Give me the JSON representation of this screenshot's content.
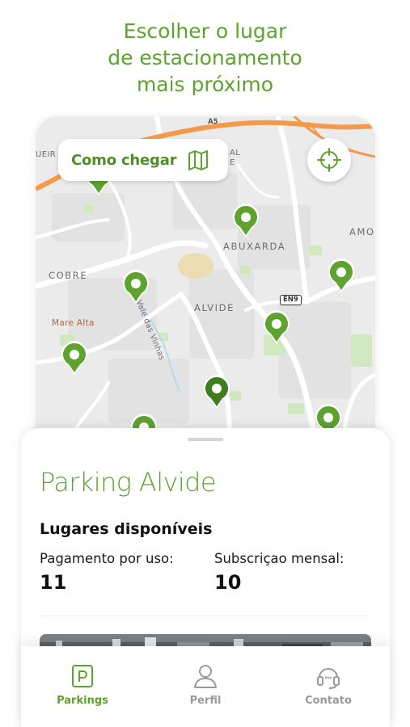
{
  "headline": {
    "line1": "Escolher o lugar",
    "line2": "de estacionamento",
    "line3": "mais próximo"
  },
  "map": {
    "labels": {
      "abuxarda": "ABUXARDA",
      "alvide": "ALVIDE",
      "cobre": "COBRE",
      "amo": "AMOI",
      "mare_alta": "Mare Alta",
      "vale_das_vinhas": "Vale das Vinhas",
      "ueir": "UEIR",
      "al": "AL",
      "e": "E"
    },
    "roads": {
      "a5": "A5",
      "en9": "EN9"
    },
    "directions_button": {
      "label": "Como chegar",
      "icon": "map-icon"
    },
    "locate_button": {
      "icon": "crosshair-icon"
    },
    "pin_icon": "parking-pin-icon",
    "colors": {
      "pin": "#5da32e",
      "pin_selected": "#3f7d1e",
      "highway": "#f29a4a"
    }
  },
  "sheet": {
    "title": "Parking Alvide",
    "section_title": "Lugares disponíveis",
    "pay_per_use_label": "Pagamento por uso:",
    "pay_per_use_value": "11",
    "monthly_label": "Subscriçao mensal:",
    "monthly_value": "10"
  },
  "tabbar": {
    "tabs": [
      {
        "label": "Parkings",
        "icon": "parking-icon",
        "active": true
      },
      {
        "label": "Perfil",
        "icon": "user-icon",
        "active": false
      },
      {
        "label": "Contato",
        "icon": "headset-icon",
        "active": false
      }
    ],
    "colors": {
      "active": "#5da32e",
      "inactive": "#9a9a9a"
    }
  },
  "colors": {
    "brand_green": "#5da32e"
  }
}
